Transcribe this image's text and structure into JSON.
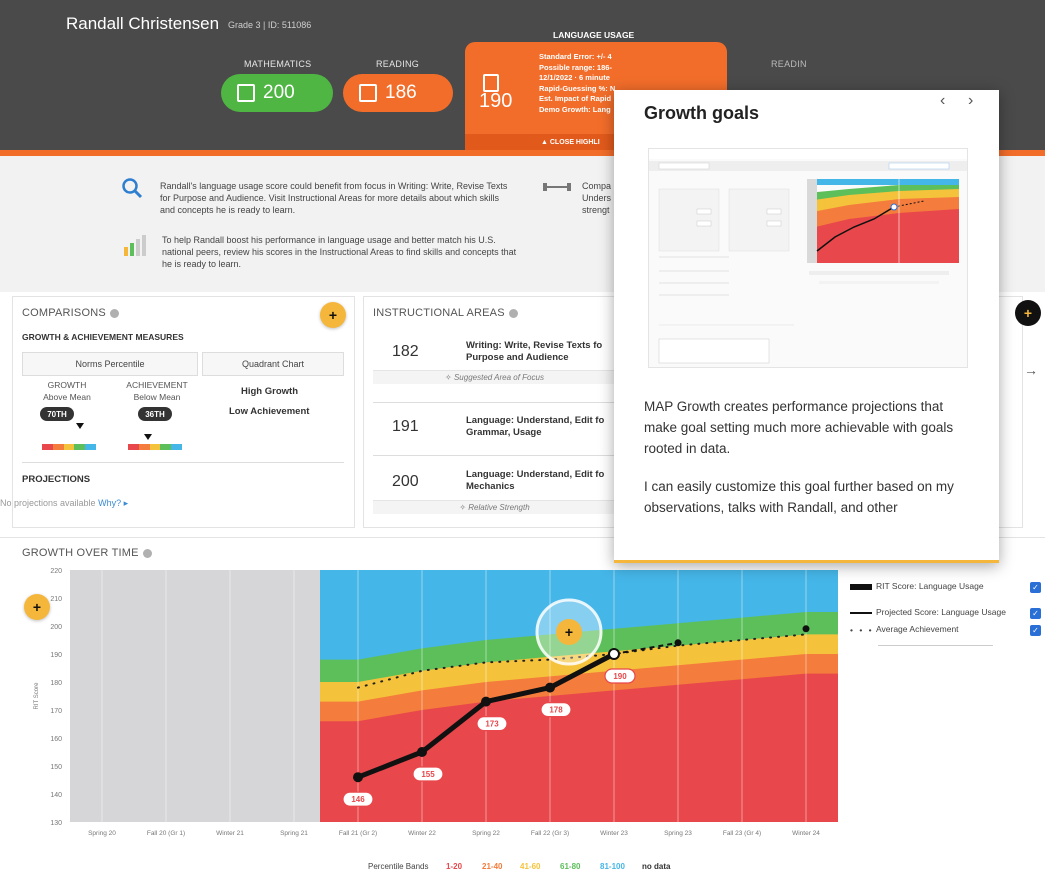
{
  "student": {
    "name": "Randall Christensen",
    "meta": "Grade 3  |  ID: 511086"
  },
  "subjects": {
    "math": {
      "label": "MATHEMATICS",
      "score": "200",
      "color": "#4fb543"
    },
    "reading": {
      "label": "READING",
      "score": "186",
      "color": "#f26d2a"
    },
    "language": {
      "label": "LANGUAGE USAGE",
      "score": "190",
      "details": [
        "Standard Error: +/- 4",
        "Possible range: 186-",
        "12/1/2022 · 6 minute",
        "Rapid-Guessing %: N",
        "Est. Impact of Rapid",
        "Demo Growth: Lang"
      ],
      "close_label": "▲ CLOSE HIGHLI"
    },
    "partial_label": "READIN"
  },
  "info": {
    "focus_text": "Randall's language usage score could benefit from focus in Writing: Write, Revise Texts for Purpose and Audience. Visit Instructional Areas for more details about which skills and concepts he is ready to learn.",
    "boost_text": "To help Randall boost his performance in language usage and better match his U.S. national peers, review his scores in the Instructional Areas to find skills and concepts that he is ready to learn.",
    "compare_text_1": "Compa",
    "compare_text_2": "Unders",
    "compare_text_3": "strengt"
  },
  "comparisons": {
    "title": "COMPARISONS",
    "subtitle": "GROWTH & ACHIEVEMENT MEASURES",
    "norms_header": "Norms Percentile",
    "quadrant_header": "Quadrant Chart",
    "growth_label": "GROWTH",
    "growth_sub": "Above Mean",
    "growth_pct": "70TH",
    "achievement_label": "ACHIEVEMENT",
    "achievement_sub": "Below Mean",
    "achievement_pct": "36TH",
    "quadrant_line1": "High Growth",
    "quadrant_line2": "Low Achievement",
    "projections_title": "PROJECTIONS",
    "no_projections": "No projections available",
    "why_link": "Why? ▸"
  },
  "instructional_areas": {
    "title": "INSTRUCTIONAL AREAS",
    "rows": [
      {
        "score": "182",
        "line1": "Writing: Write, Revise Texts fo",
        "line2": "Purpose and Audience",
        "note": "✧ Suggested Area of Focus"
      },
      {
        "score": "191",
        "line1": "Language: Understand, Edit fo",
        "line2": "Grammar, Usage",
        "note": ""
      },
      {
        "score": "200",
        "line1": "Language: Understand, Edit fo",
        "line2": "Mechanics",
        "note": "✧ Relative Strength"
      }
    ]
  },
  "growth_over_time": {
    "title": "GROWTH OVER TIME",
    "legend": [
      {
        "label": "RIT Score: Language Usage"
      },
      {
        "label": "Projected Score: Language Usage"
      },
      {
        "label": "Average Achievement"
      }
    ],
    "band_legend_label": "Percentile Bands",
    "bands": [
      {
        "label": "1-20",
        "color": "#e8474b"
      },
      {
        "label": "21-40",
        "color": "#f47c3c"
      },
      {
        "label": "41-60",
        "color": "#f5c33b"
      },
      {
        "label": "61-80",
        "color": "#5cbf5a"
      },
      {
        "label": "81-100",
        "color": "#45b6e8"
      },
      {
        "label": "no data",
        "color": "#333333"
      }
    ]
  },
  "chart_data": {
    "type": "line",
    "title": "",
    "xlabel": "",
    "ylabel": "RIT Score",
    "ylim": [
      130,
      220
    ],
    "yticks": [
      130,
      140,
      150,
      160,
      170,
      180,
      190,
      200,
      210,
      220
    ],
    "categories": [
      "Spring 20",
      "Fall 20 (Gr 1)",
      "Winter 21",
      "Spring 21",
      "Fall 21 (Gr 2)",
      "Winter 22",
      "Spring 22",
      "Fall 22 (Gr 3)",
      "Winter 23",
      "Spring 23",
      "Fall 23 (Gr 4)",
      "Winter 24"
    ],
    "series": [
      {
        "name": "RIT Score: Language Usage",
        "x_index": [
          4,
          5,
          6,
          7,
          8
        ],
        "values": [
          146,
          155,
          173,
          178,
          190
        ]
      },
      {
        "name": "Projected Score: Language Usage",
        "x_index": [
          8,
          9
        ],
        "values": [
          190,
          194
        ]
      },
      {
        "name": "Average Achievement",
        "x_index": [
          4,
          5,
          6,
          7,
          8,
          9,
          10,
          11
        ],
        "values": [
          178,
          184,
          187,
          188,
          190,
          193,
          195,
          197
        ]
      }
    ],
    "marker": {
      "x_index": 11,
      "value": 199
    },
    "point_labels": [
      "146",
      "155",
      "173",
      "178",
      "190"
    ]
  },
  "popup": {
    "title": "Growth goals",
    "paragraph1": "MAP Growth creates performance projections that make goal setting much more achievable with goals rooted in data.",
    "paragraph2": "I can easily customize this goal further based on my observations, talks with Randall, and other"
  }
}
